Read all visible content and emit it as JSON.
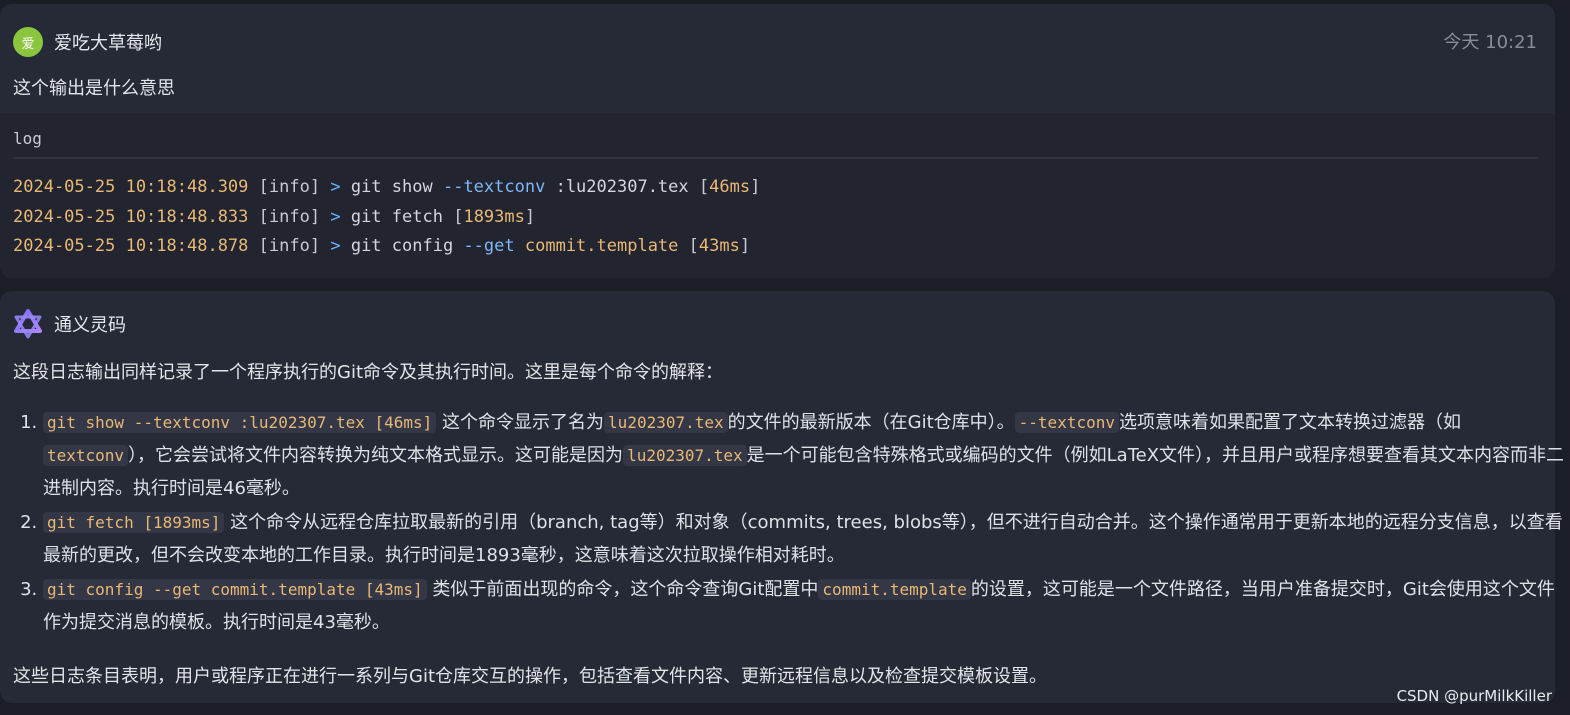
{
  "user_message": {
    "avatar_char": "爱",
    "username": "爱吃大草莓哟",
    "time": "今天 10:21",
    "text": "这个输出是什么意思",
    "code_lang": "log",
    "lines": [
      {
        "ts": "2024-05-25 10:18:48.309",
        "level": "[info]",
        "arrow": ">",
        "cmd": "git show",
        "flag": "--textconv",
        "arg": ":lu202307.tex",
        "arg_hl": false,
        "ms": "46ms"
      },
      {
        "ts": "2024-05-25 10:18:48.833",
        "level": "[info]",
        "arrow": ">",
        "cmd": "git fetch",
        "flag": "",
        "arg": "",
        "arg_hl": false,
        "ms": "1893ms"
      },
      {
        "ts": "2024-05-25 10:18:48.878",
        "level": "[info]",
        "arrow": ">",
        "cmd": "git config",
        "flag": "--get",
        "arg": "commit.template",
        "arg_hl": true,
        "ms": "43ms"
      }
    ]
  },
  "ai_message": {
    "name": "通义灵码",
    "intro": "这段日志输出同样记录了一个程序执行的Git命令及其执行时间。这里是每个命令的解释：",
    "items": [
      {
        "parts": [
          {
            "code": "git show --textconv :lu202307.tex [46ms]"
          },
          {
            "text": " 这个命令显示了名为"
          },
          {
            "code": "lu202307.tex"
          },
          {
            "text": "的文件的最新版本（在Git仓库中）。"
          },
          {
            "code": "--textconv"
          },
          {
            "text": "选项意味着如果配置了文本转换过滤器（如"
          },
          {
            "code": "textconv"
          },
          {
            "text": "），它会尝试将文件内容转换为纯文本格式显示。这可能是因为"
          },
          {
            "code": "lu202307.tex"
          },
          {
            "text": "是一个可能包含特殊格式或编码的文件（例如LaTeX文件），并且用户或程序想要查看其文本内容而非二进制内容。执行时间是46毫秒。"
          }
        ]
      },
      {
        "parts": [
          {
            "code": "git fetch [1893ms]"
          },
          {
            "text": " 这个命令从远程仓库拉取最新的引用（branch, tag等）和对象（commits, trees, blobs等），但不进行自动合并。这个操作通常用于更新本地的远程分支信息，以查看最新的更改，但不会改变本地的工作目录。执行时间是1893毫秒，这意味着这次拉取操作相对耗时。"
          }
        ]
      },
      {
        "parts": [
          {
            "code": "git config --get commit.template [43ms]"
          },
          {
            "text": " 类似于前面出现的命令，这个命令查询Git配置中"
          },
          {
            "code": "commit.template"
          },
          {
            "text": "的设置，这可能是一个文件路径，当用户准备提交时，Git会使用这个文件作为提交消息的模板。执行时间是43毫秒。"
          }
        ]
      }
    ],
    "summary": "这些日志条目表明，用户或程序正在进行一系列与Git仓库交互的操作，包括查看文件内容、更新远程信息以及检查提交模板设置。"
  },
  "watermark": "CSDN @purMilkKiller",
  "colors": {
    "avatar": "#8ac53e",
    "card": "#262936",
    "code_bg": "#22242f",
    "timestamp": "#e8b875",
    "arrow": "#6fb3ff"
  },
  "icons": {
    "ai_logo": "tongyi-logo-icon"
  }
}
